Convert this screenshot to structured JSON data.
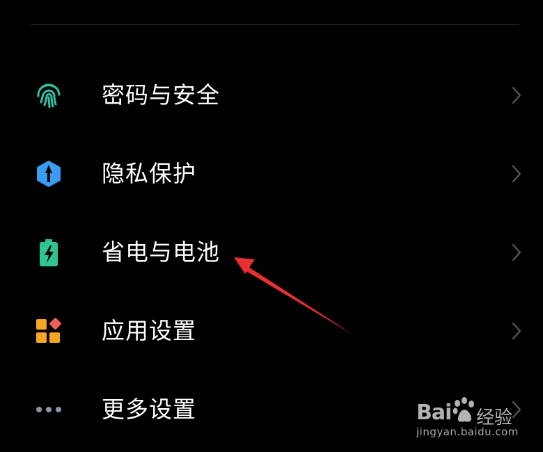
{
  "settings": {
    "items": [
      {
        "label": "密码与安全",
        "icon": "fingerprint-icon",
        "icon_color": "#33c1a4"
      },
      {
        "label": "隐私保护",
        "icon": "privacy-shield-icon",
        "icon_color": "#3a9bf2"
      },
      {
        "label": "省电与电池",
        "icon": "battery-icon",
        "icon_color": "#2fc593"
      },
      {
        "label": "应用设置",
        "icon": "apps-icon",
        "icon_color": "#f6a623"
      },
      {
        "label": "更多设置",
        "icon": "more-dots-icon",
        "icon_color": "#8a97a8"
      }
    ]
  },
  "annotation": {
    "color": "#e8312f"
  },
  "watermark": {
    "brand": "Bai",
    "brand_suffix": "经验",
    "url": "jingyan.baidu.com"
  }
}
